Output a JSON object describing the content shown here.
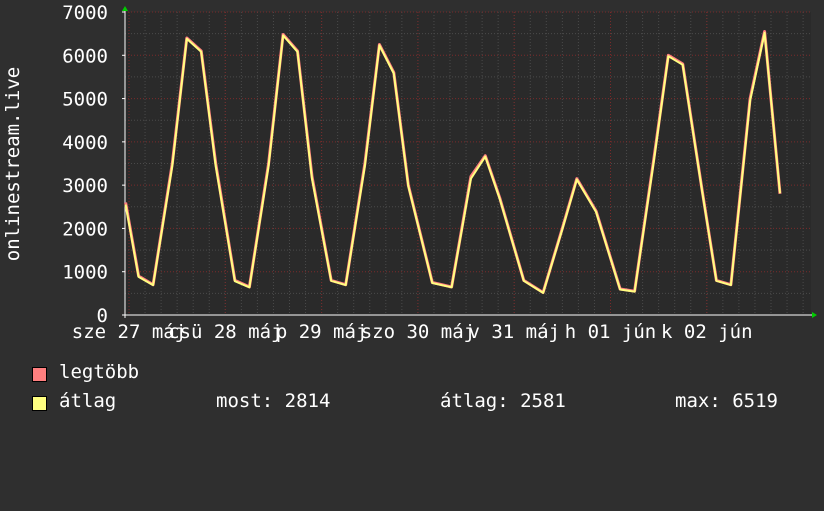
{
  "chart_data": {
    "type": "line",
    "ylabel": "onlinestream.live",
    "ylim": [
      0,
      7000
    ],
    "yticks": [
      "0",
      "1000",
      "2000",
      "3000",
      "4000",
      "5000",
      "6000",
      "7000"
    ],
    "x_ticks": [
      {
        "label": "sze 27 máj",
        "pos": 0
      },
      {
        "label": "csü 28 máj",
        "pos": 1
      },
      {
        "label": "p 29 máj",
        "pos": 2
      },
      {
        "label": "szo 30 máj",
        "pos": 3
      },
      {
        "label": "v 31 máj",
        "pos": 4
      },
      {
        "label": "h 01 jún",
        "pos": 5
      },
      {
        "label": "k 02 jún",
        "pos": 6
      }
    ],
    "grid": true,
    "series": [
      {
        "name": "legtöbb",
        "color": "#ff7f7f",
        "x": [
          -0.035,
          0.1,
          0.25,
          0.45,
          0.6,
          0.75,
          0.9,
          1.1,
          1.25,
          1.45,
          1.6,
          1.75,
          1.9,
          2.1,
          2.25,
          2.45,
          2.6,
          2.75,
          2.9,
          3.15,
          3.35,
          3.55,
          3.7,
          3.85,
          4.1,
          4.3,
          4.5,
          4.65,
          4.85,
          5.1,
          5.25,
          5.45,
          5.6,
          5.75,
          5.95,
          6.1,
          6.25,
          6.45,
          6.6,
          6.76
        ],
        "values": [
          2600,
          900,
          700,
          3500,
          6400,
          6100,
          3500,
          800,
          650,
          3500,
          6480,
          6100,
          3200,
          800,
          700,
          3500,
          6250,
          5600,
          3000,
          750,
          650,
          3200,
          3680,
          2700,
          800,
          520,
          2000,
          3150,
          2400,
          600,
          550,
          3600,
          6000,
          5800,
          2900,
          800,
          700,
          5000,
          6550,
          2800
        ]
      },
      {
        "name": "átlag",
        "color": "#ffff80",
        "x": [
          -0.035,
          0.1,
          0.25,
          0.45,
          0.6,
          0.75,
          0.9,
          1.1,
          1.25,
          1.45,
          1.6,
          1.75,
          1.9,
          2.1,
          2.25,
          2.45,
          2.6,
          2.75,
          2.9,
          3.15,
          3.35,
          3.55,
          3.7,
          3.85,
          4.1,
          4.3,
          4.5,
          4.65,
          4.85,
          5.1,
          5.25,
          5.45,
          5.6,
          5.75,
          5.95,
          6.1,
          6.25,
          6.45,
          6.6,
          6.76
        ],
        "values": [
          2550,
          880,
          690,
          3450,
          6380,
          6080,
          3450,
          780,
          640,
          3450,
          6460,
          6080,
          3150,
          790,
          690,
          3450,
          6230,
          5580,
          2980,
          740,
          640,
          3150,
          3660,
          2680,
          790,
          510,
          1980,
          3130,
          2380,
          590,
          540,
          3550,
          5980,
          5780,
          2880,
          790,
          690,
          4950,
          6519,
          2814
        ]
      }
    ]
  },
  "legend": {
    "max_label": "legtöbb",
    "avg_label": "átlag",
    "most": "most: 2814",
    "atlag": "átlag: 2581",
    "max": "max: 6519"
  },
  "colors": {
    "background": "#2f2f2f",
    "canvas": "#2a2a2a",
    "grid_major": "#7a2a2a",
    "grid_minor": "#4a4a4a",
    "axis": "#ffffff",
    "arrow": "#00cc00",
    "text": "#ffffff"
  }
}
